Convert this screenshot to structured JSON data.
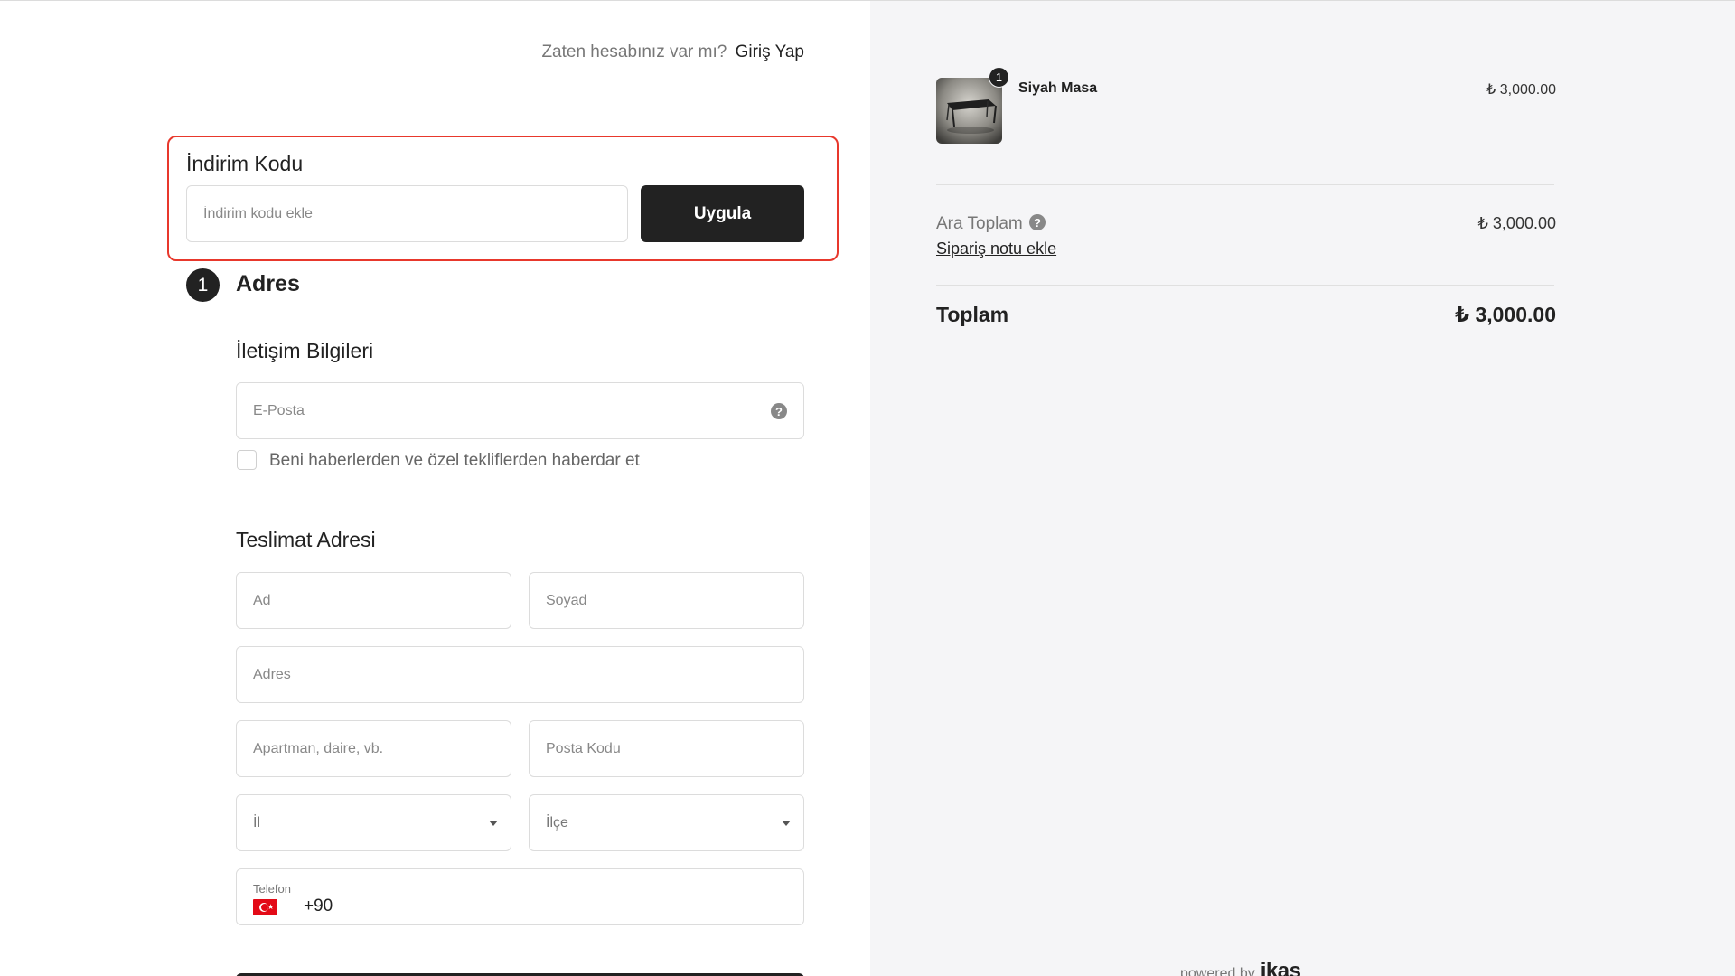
{
  "header": {
    "have_account_text": "Zaten hesabınız var mı?",
    "login_link": "Giriş Yap"
  },
  "discount": {
    "title": "İndirim Kodu",
    "placeholder": "İndirim kodu ekle",
    "apply_label": "Uygula",
    "highlight_color": "#e8382c"
  },
  "address_step": {
    "number": "1",
    "title": "Adres",
    "contact": {
      "title": "İletişim Bilgileri",
      "email_placeholder": "E-Posta",
      "newsletter_label": "Beni haberlerden ve özel tekliflerden haberdar et",
      "newsletter_checked": false
    },
    "shipping": {
      "title": "Teslimat Adresi",
      "first_name_placeholder": "Ad",
      "last_name_placeholder": "Soyad",
      "address_placeholder": "Adres",
      "apartment_placeholder": "Apartman, daire, vb.",
      "postal_code_placeholder": "Posta Kodu",
      "province_label": "İl",
      "district_label": "İlçe",
      "phone_label": "Telefon",
      "phone_country_code": "+90"
    }
  },
  "summary": {
    "product": {
      "name": "Siyah Masa",
      "price": "₺ 3,000.00",
      "quantity": "1"
    },
    "subtotal_label": "Ara Toplam",
    "subtotal_value": "₺ 3,000.00",
    "order_note_link": "Sipariş notu ekle",
    "total_label": "Toplam",
    "total_value": "₺ 3,000.00"
  },
  "footer": {
    "powered_by": "powered by",
    "brand": "ikas"
  },
  "colors": {
    "primary": "#222222",
    "right_panel_bg": "#f5f5f7"
  }
}
